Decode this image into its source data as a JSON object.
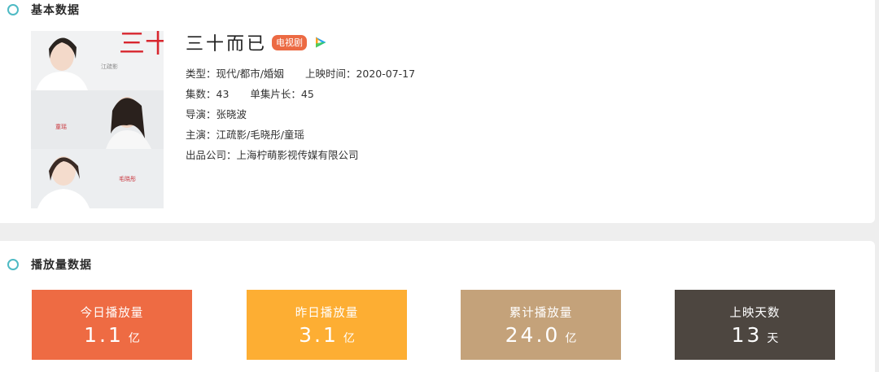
{
  "basic": {
    "section_title": "基本数据",
    "title": "三十而已",
    "badge": "电视剧",
    "info": {
      "genre_line": "类型：现代/都市/婚姻",
      "release_line": "上映时间：2020-07-17",
      "episodes_line": "集数：43",
      "duration_line": "单集片长：45",
      "director_line": "导演：张晓波",
      "cast_line": "主演：江疏影/毛晓彤/童瑶",
      "company_line": "出品公司：上海柠萌影视传媒有限公司"
    },
    "poster": {
      "title_calligraphy": "三十而已",
      "name_1": "江疏影",
      "name_2": "童瑶",
      "name_3": "毛晓彤"
    }
  },
  "play": {
    "section_title": "播放量数据",
    "cards": [
      {
        "label": "今日播放量",
        "value": "1.1",
        "unit": "亿",
        "color": "#ee6b43"
      },
      {
        "label": "昨日播放量",
        "value": "3.1",
        "unit": "亿",
        "color": "#fdae33"
      },
      {
        "label": "累计播放量",
        "value": "24.0",
        "unit": "亿",
        "color": "#c4a27a"
      },
      {
        "label": "上映天数",
        "value": "13",
        "unit": "天",
        "color": "#4d4640"
      }
    ]
  },
  "colors": {
    "accent_ring": "#4ebac4",
    "badge": "#ec6a43"
  },
  "icons": {
    "section": "ring-icon",
    "platform": "tencent-video-play-icon"
  }
}
